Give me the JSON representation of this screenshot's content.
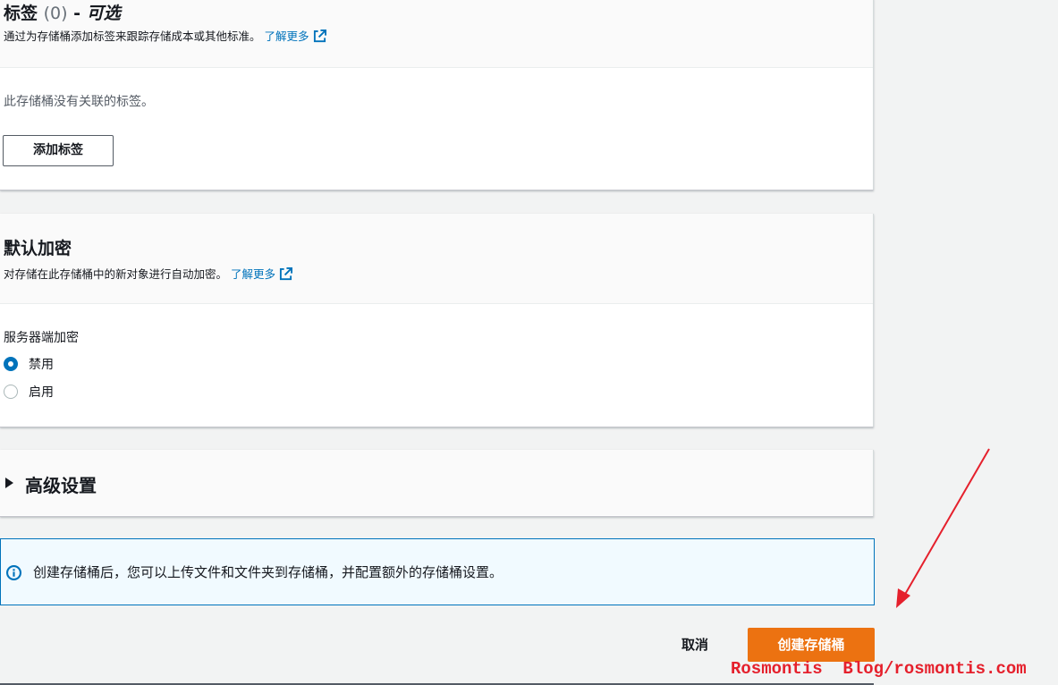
{
  "tags": {
    "title": "标签",
    "count": "(0)",
    "separator": " - ",
    "optional": "可选",
    "description": "通过为存储桶添加标签来跟踪存储成本或其他标准。",
    "learn_more": "了解更多",
    "empty_text": "此存储桶没有关联的标签。",
    "add_button": "添加标签"
  },
  "encryption": {
    "title": "默认加密",
    "description": "对存储在此存储桶中的新对象进行自动加密。",
    "learn_more": "了解更多",
    "field_label": "服务器端加密",
    "options": [
      {
        "label": "禁用",
        "selected": true
      },
      {
        "label": "启用",
        "selected": false
      }
    ]
  },
  "advanced": {
    "title": "高级设置"
  },
  "info": {
    "text": "创建存储桶后，您可以上传文件和文件夹到存储桶，并配置额外的存储桶设置。"
  },
  "actions": {
    "cancel": "取消",
    "create": "创建存储桶"
  },
  "watermark": "Rosmontis  Blog/rosmontis.com",
  "colors": {
    "primary": "#ec7211",
    "link": "#0073bb",
    "annotation": "#e5202c"
  },
  "icons": {
    "external": "external-link-icon",
    "info": "info-circle-icon",
    "caret": "caret-right-icon"
  }
}
